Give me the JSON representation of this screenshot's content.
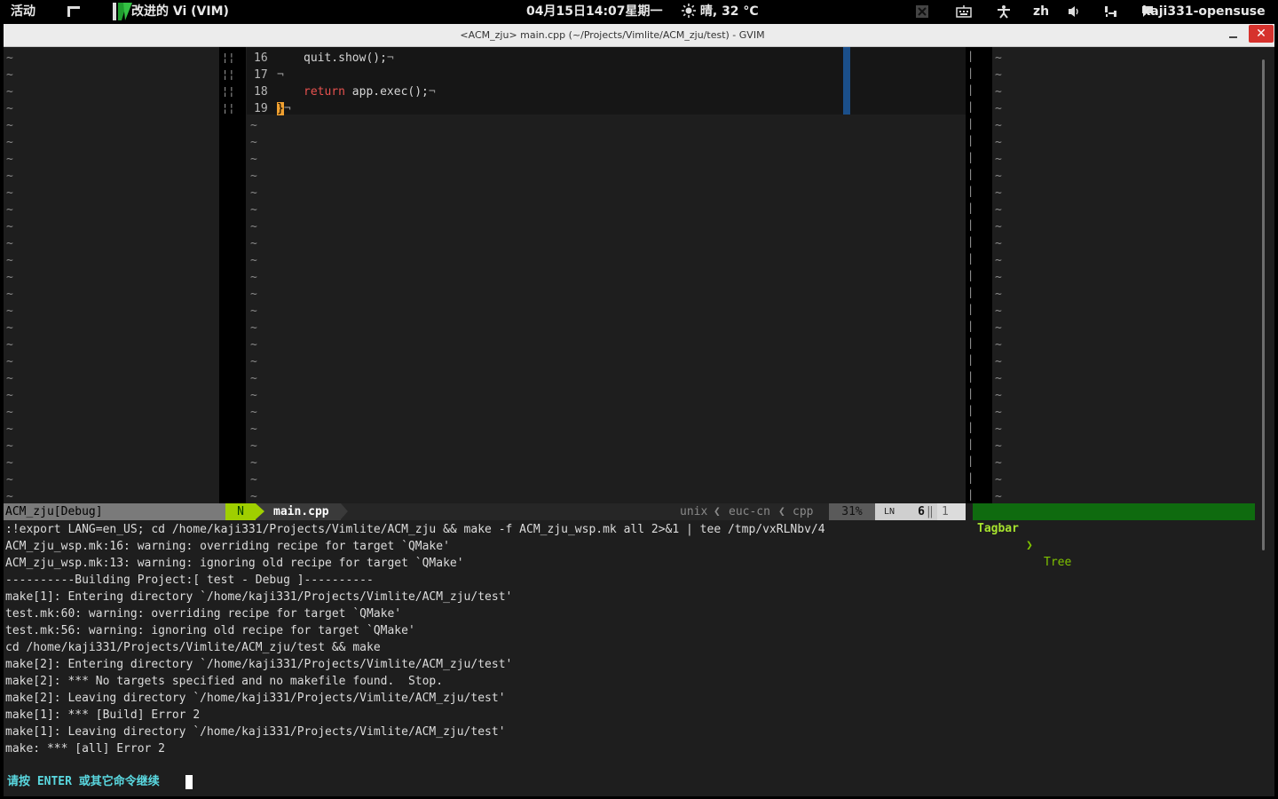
{
  "topbar": {
    "activities": "活动",
    "app_name": "改进的 Vi (VIM)",
    "clock": "04月15日14:07星期一",
    "weather": "晴, 32 °C",
    "lang": "zh",
    "user": "kaji331-opensuse",
    "icons": [
      "close-square-icon",
      "keyboard-icon",
      "accessibility-icon",
      "volume-icon",
      "network-icon",
      "chat-icon"
    ]
  },
  "window": {
    "title": "<ACM_zju> main.cpp (~/Projects/Vimlite/ACM_zju/test) - GVIM",
    "close_label": "✕"
  },
  "editor": {
    "code_lines": [
      {
        "num": "16",
        "indent": "    ",
        "kw": "",
        "text": "quit.show();",
        "eol": "¬"
      },
      {
        "num": "17",
        "indent": "",
        "kw": "",
        "text": "",
        "eol": "¬"
      },
      {
        "num": "18",
        "indent": "    ",
        "kw": "return",
        "text": " app.exec();",
        "eol": "¬"
      },
      {
        "num": "19",
        "indent": "",
        "kw": "",
        "text": "}",
        "eol": "¬"
      }
    ],
    "tilde": "~"
  },
  "statusline": {
    "left": "ACM_zju[Debug]",
    "mode": "N",
    "file": "main.cpp",
    "fileformat": "unix",
    "encoding": "euc-cn",
    "filetype": "cpp",
    "percent": "31%",
    "line": "6",
    "col": "1",
    "tagbar": "Tagbar",
    "tree": "Tree"
  },
  "output": {
    "lines": [
      ":!export LANG=en_US; cd /home/kaji331/Projects/Vimlite/ACM_zju && make -f ACM_zju_wsp.mk all 2>&1 | tee /tmp/vxRLNbv/4",
      "ACM_zju_wsp.mk:16: warning: overriding recipe for target `QMake'",
      "ACM_zju_wsp.mk:13: warning: ignoring old recipe for target `QMake'",
      "----------Building Project:[ test - Debug ]----------",
      "make[1]: Entering directory `/home/kaji331/Projects/Vimlite/ACM_zju/test'",
      "test.mk:60: warning: overriding recipe for target `QMake'",
      "test.mk:56: warning: ignoring old recipe for target `QMake'",
      "cd /home/kaji331/Projects/Vimlite/ACM_zju/test && make",
      "make[2]: Entering directory `/home/kaji331/Projects/Vimlite/ACM_zju/test'",
      "make[2]: *** No targets specified and no makefile found.  Stop.",
      "make[2]: Leaving directory `/home/kaji331/Projects/Vimlite/ACM_zju/test'",
      "make[1]: *** [Build] Error 2",
      "make[1]: Leaving directory `/home/kaji331/Projects/Vimlite/ACM_zju/test'",
      "make: *** [all] Error 2"
    ],
    "prompt": "请按 ENTER 或其它命令继续"
  },
  "colors": {
    "mode_bg": "#9fcf00",
    "tagbar_bg": "#0f6b0f",
    "keyword": "#e8524f",
    "prompt": "#5ad8e0",
    "close_btn": "#d6322d"
  }
}
